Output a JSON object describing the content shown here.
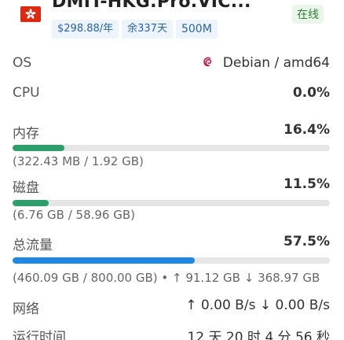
{
  "header": {
    "title": "DMIT-HKG.Pro.VIC...",
    "status": "在线",
    "tags": {
      "price": "$298.88/年",
      "remaining": "余337天",
      "traffic": "500M"
    }
  },
  "rows": {
    "os": {
      "label": "OS",
      "value": "Debian / amd64",
      "icon": "debian-icon"
    },
    "cpu": {
      "label": "CPU",
      "value": "0.0%"
    },
    "memory": {
      "label": "内存",
      "value": "16.4%",
      "percent": 16.4,
      "detail": "(322.43 MB / 1.92 GB)"
    },
    "disk": {
      "label": "磁盘",
      "value": "11.5%",
      "percent": 11.5,
      "detail": "(6.76 GB / 58.96 GB)"
    },
    "traffic": {
      "label": "总流量",
      "value": "57.5%",
      "percent": 57.5,
      "detail": "(460.09 GB / 800.00 GB) • ↑ 91.12 GB ↓ 368.97 GB"
    },
    "network": {
      "label": "网络",
      "value": "↑ 0.00 B/s ↓ 0.00 B/s"
    },
    "uptime": {
      "label": "运行时间",
      "value": "12 天 20 时 4 分 56 秒"
    }
  },
  "colors": {
    "memory_bar": "#2e9e6a",
    "disk_bar": "#2e9e6a",
    "traffic_bar": "#1e88e5",
    "status": "#2e7d32",
    "flag": "#de2910"
  }
}
